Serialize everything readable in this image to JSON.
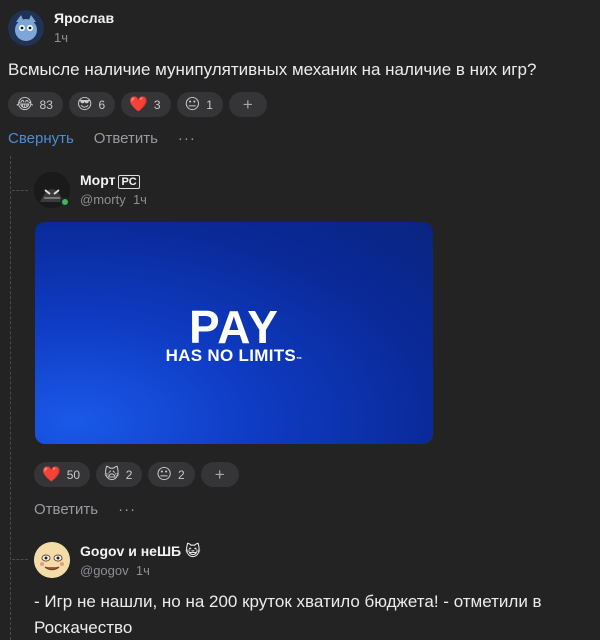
{
  "comments": [
    {
      "author": "Ярослав",
      "time": "1ч",
      "text": "Всмысле наличие мунипулятивных механик на наличие в них игр?",
      "reactions": [
        {
          "emoji": "😂",
          "count": "83"
        },
        {
          "emoji": "😎",
          "count": "6"
        },
        {
          "emoji": "❤️",
          "count": "3"
        },
        {
          "emoji": "😐",
          "count": "1"
        }
      ],
      "actions": {
        "collapse": "Свернуть",
        "reply": "Ответить",
        "more": "···"
      }
    },
    {
      "author": "Морт",
      "author_badge": "PC",
      "handle": "@morty",
      "time": "1ч",
      "media": {
        "line1": "PAY",
        "line2": "HAS NO LIMITS",
        "tm": "™"
      },
      "reactions": [
        {
          "emoji": "❤️",
          "count": "50"
        },
        {
          "emoji": "🙀",
          "count": "2"
        },
        {
          "emoji": "😐",
          "count": "2"
        }
      ],
      "actions": {
        "reply": "Ответить",
        "more": "···"
      }
    },
    {
      "author": "Gogov и неШБ",
      "author_emoji": "😺",
      "handle": "@gogov",
      "time": "1ч",
      "text": "- Игр не нашли, но на 200 круток хватило бюджета! - отметили в Роскачество"
    }
  ],
  "add_reaction_label": "+",
  "colors": {
    "background": "#232324",
    "pill": "#353537",
    "link": "#4c8dd6",
    "media": "#0f3cc4"
  }
}
